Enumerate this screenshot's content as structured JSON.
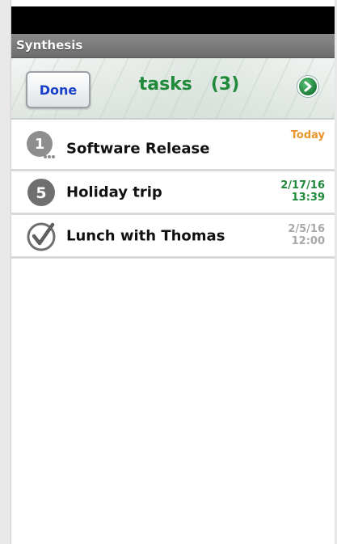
{
  "app": {
    "title": "Synthesis"
  },
  "header": {
    "done_label": "Done",
    "title": "tasks",
    "count": "(3)"
  },
  "tasks": [
    {
      "badge": "1",
      "icon": "priority-1-icon",
      "title": "Software Release",
      "date": "Today",
      "time": "",
      "date_color": "#e8962a"
    },
    {
      "badge": "5",
      "icon": "priority-5-icon",
      "title": "Holiday trip",
      "date": "2/17/16",
      "time": "13:39",
      "date_color": "#1f8a3a"
    },
    {
      "badge": "",
      "icon": "completed-check-icon",
      "title": "Lunch with Thomas",
      "date": "2/5/16",
      "time": "12:00",
      "date_color": "#a8a8a8"
    }
  ],
  "colors": {
    "accent_green": "#1f8a3a",
    "done_blue": "#1a3fc8",
    "today_orange": "#e8962a",
    "muted_gray": "#a8a8a8"
  }
}
